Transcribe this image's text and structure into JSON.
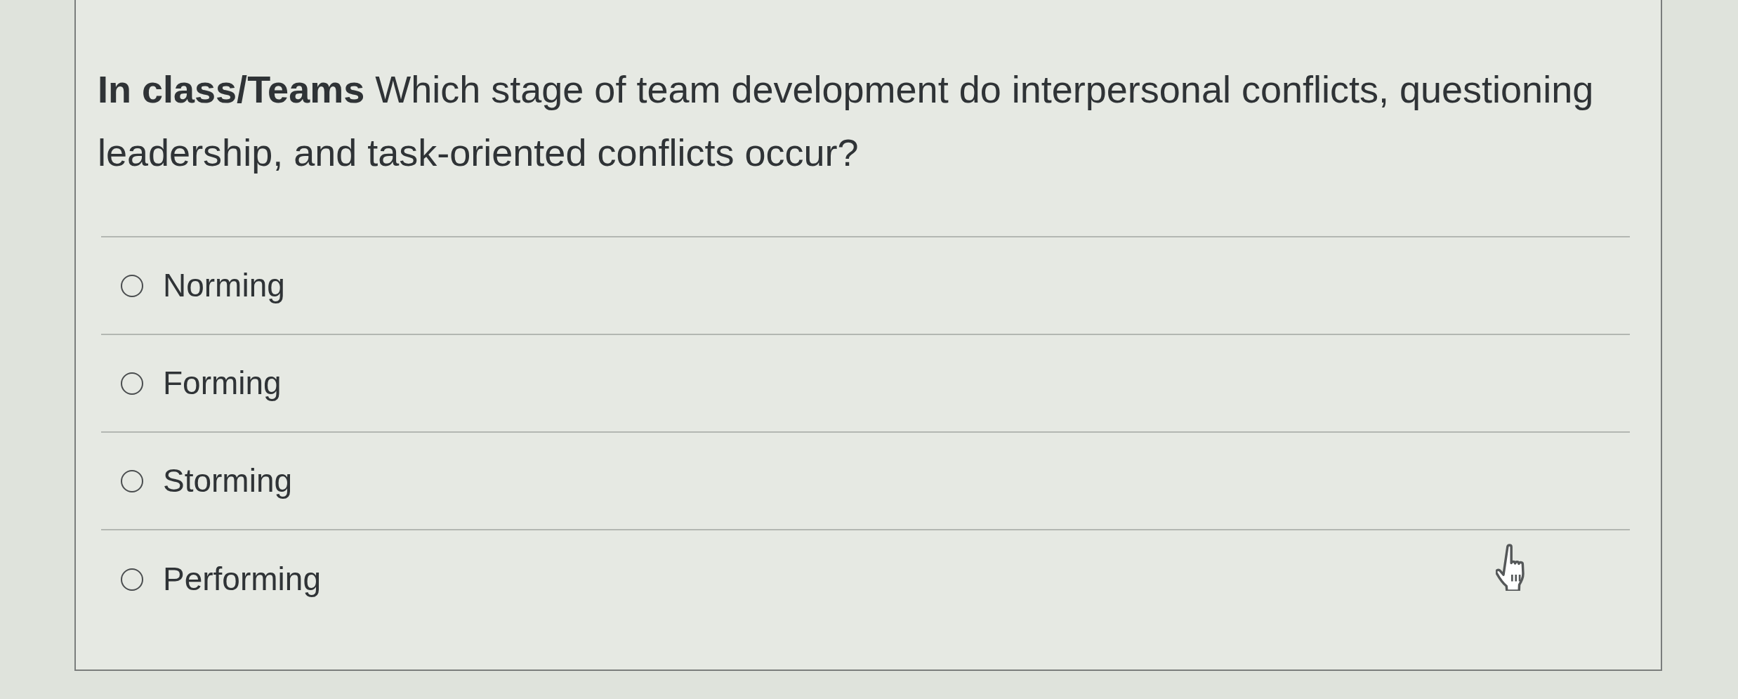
{
  "question": {
    "text": "**In class/Teams** Which stage of team development do interpersonal conflicts, questioning leadership, and task-oriented conflicts occur?"
  },
  "answers": [
    {
      "label": "Norming",
      "selected": false
    },
    {
      "label": "Forming",
      "selected": false
    },
    {
      "label": "Storming",
      "selected": false
    },
    {
      "label": "Performing",
      "selected": false
    }
  ]
}
